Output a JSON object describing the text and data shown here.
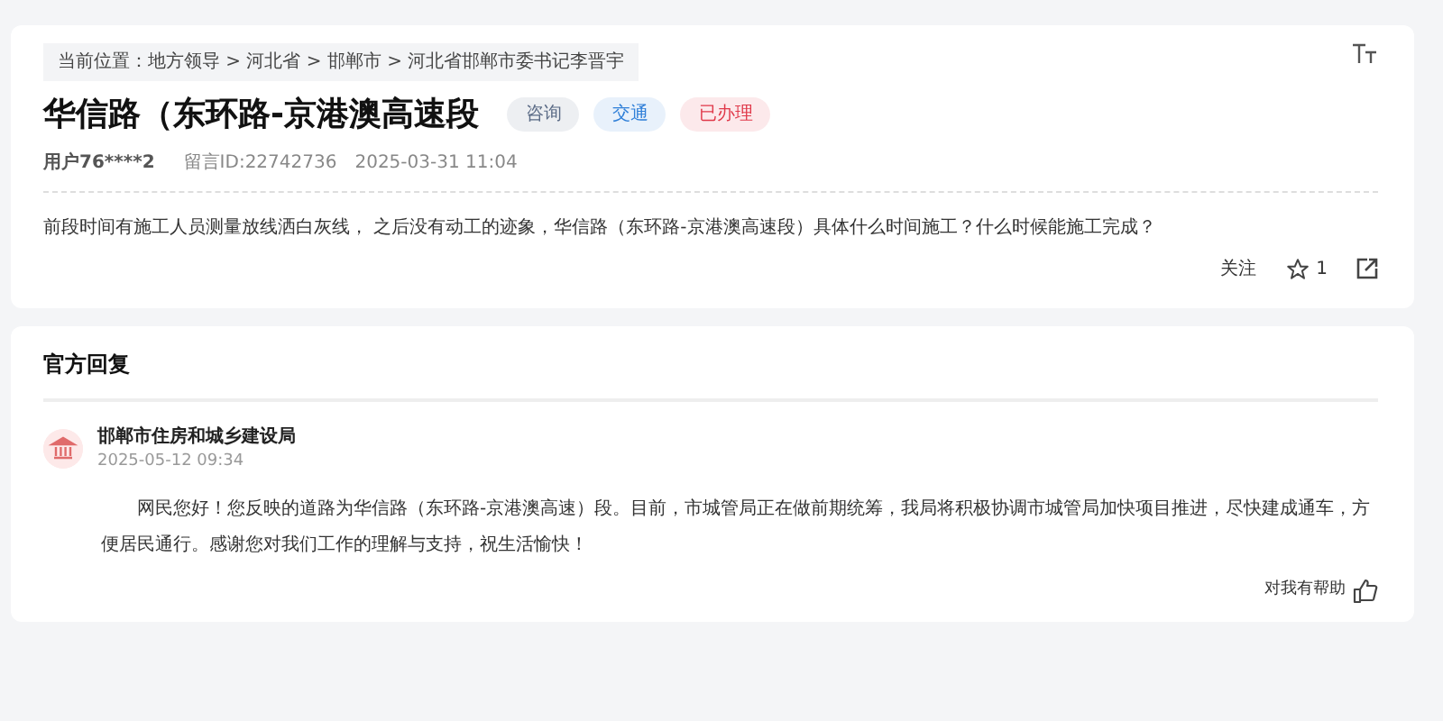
{
  "breadcrumb": "当前位置：地方领导 > 河北省 > 邯郸市 > 河北省邯郸市委书记李晋宇",
  "title": "华信路（东环路-京港澳高速段",
  "tags": [
    {
      "label": "咨询",
      "color": "#5b6b86"
    },
    {
      "label": "交通",
      "color": "#2f7fd8"
    },
    {
      "label": "已办理",
      "color": "#e0394a"
    }
  ],
  "meta": {
    "user": "用户76****2",
    "message_id": "留言ID:22742736",
    "time": "2025-03-31 11:04"
  },
  "question": "前段时间有施工人员测量放线洒白灰线， 之后没有动工的迹象，华信路（东环路-京港澳高速段）具体什么时间施工？什么时候能施工完成？",
  "actions": {
    "follow": "关注",
    "star_count": "1"
  },
  "reply_section": {
    "heading": "官方回复",
    "department": "邯郸市住房和城乡建设局",
    "time": "2025-05-12 09:34",
    "text": "网民您好！您反映的道路为华信路（东环路-京港澳高速）段。目前，市城管局正在做前期统筹，我局将积极协调市城管局加快项目推进，尽快建成通车，方便居民通行。感谢您对我们工作的理解与支持，祝生活愉快！",
    "helpful": "对我有帮助"
  }
}
